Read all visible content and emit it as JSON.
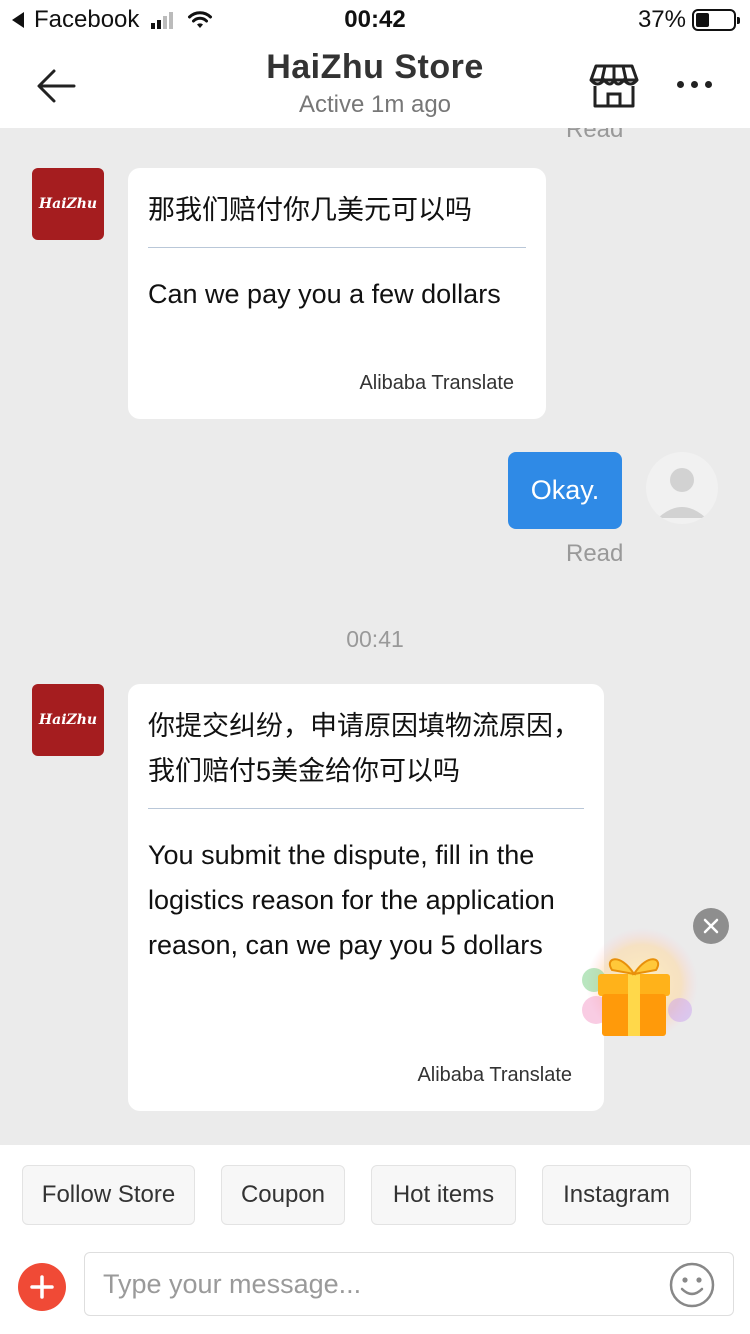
{
  "status_bar": {
    "back_app": "Facebook",
    "time": "00:42",
    "battery": "37%",
    "battery_level": 0.37
  },
  "header": {
    "title": "HaiZhu Store",
    "subtitle": "Active 1m ago"
  },
  "store_avatar_logo": "HaiZhu",
  "messages": [
    {
      "original": "那我们赔付你几美元可以吗",
      "translation": "Can we pay you a few dollars",
      "translator": "Alibaba Translate"
    },
    {
      "text": "Okay.",
      "status": "Read"
    },
    {
      "timestamp": "00:41"
    },
    {
      "original": "你提交纠纷，申请原因填物流原因，我们赔付5美金给你可以吗",
      "translation": "You submit the dispute, fill in the logistics reason for the application reason, can we pay you 5 dollars",
      "translator": "Alibaba Translate"
    }
  ],
  "top_read_label": "Read",
  "quick_replies": [
    "Follow Store",
    "Coupon",
    "Hot items",
    "Instagram"
  ],
  "composer": {
    "placeholder": "Type your message..."
  },
  "colors": {
    "brand_red": "#a51d1f",
    "my_bubble": "#2f8ae6",
    "add_button": "#f04a36",
    "chat_bg": "#ebebeb"
  },
  "icons": [
    "back-arrow-icon",
    "store-icon",
    "more-icon",
    "plus-icon",
    "emoji-icon",
    "close-icon",
    "gift-icon",
    "wifi-icon",
    "signal-icon",
    "battery-icon"
  ]
}
